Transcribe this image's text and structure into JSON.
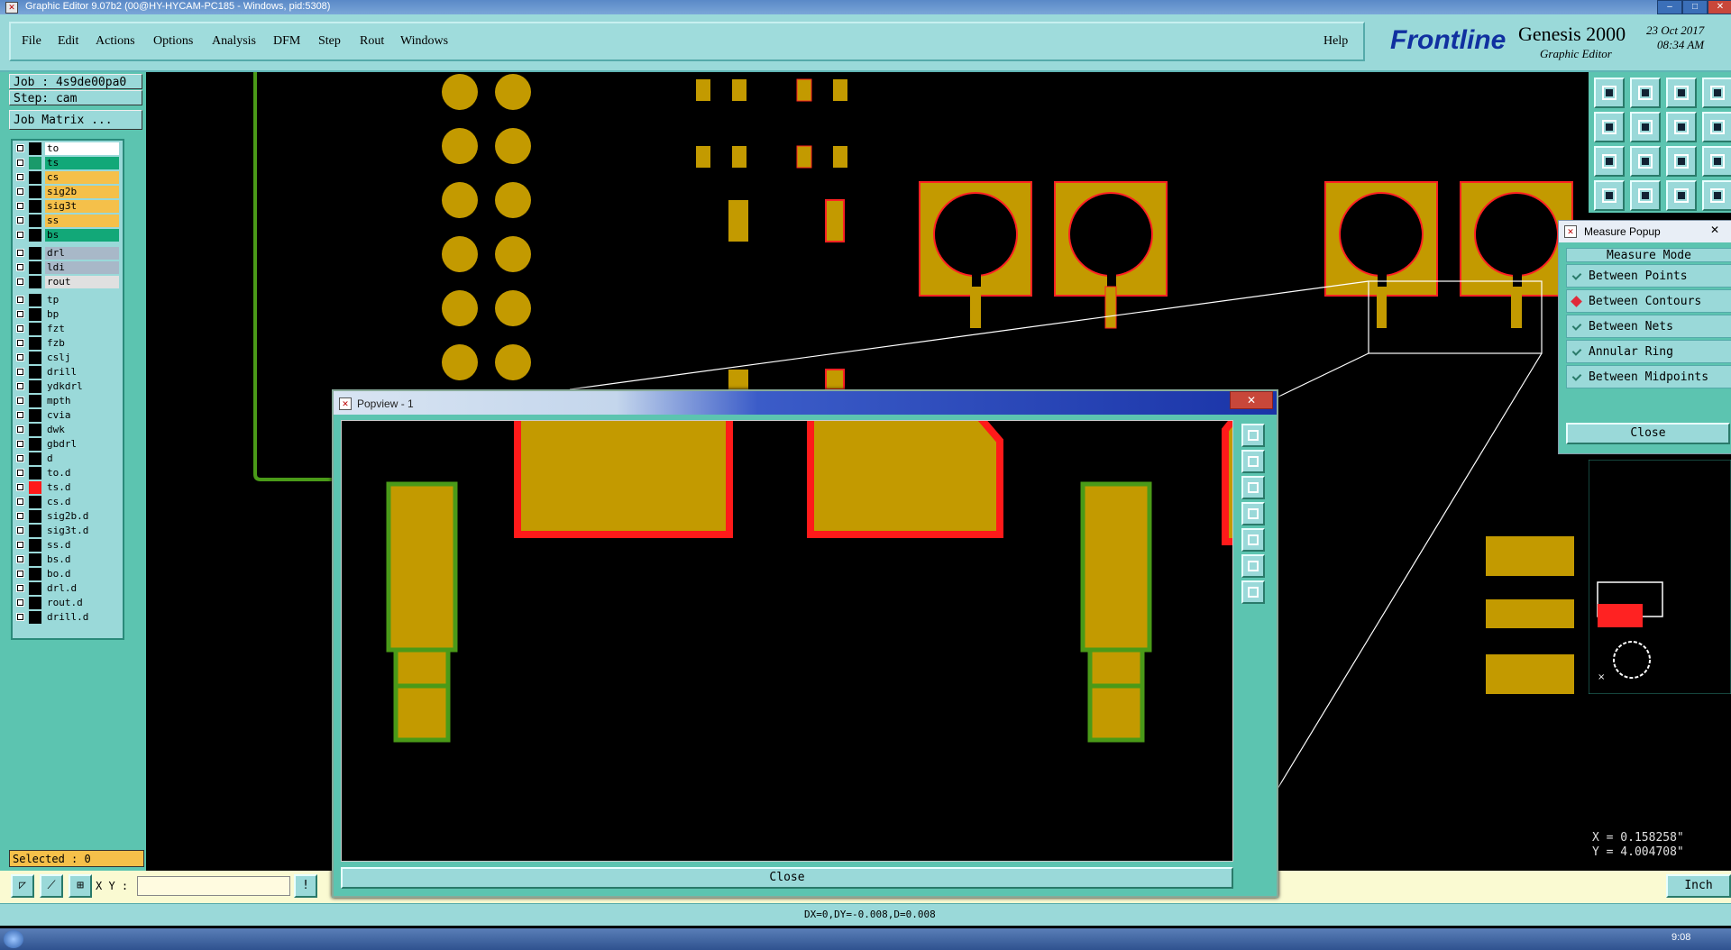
{
  "window": {
    "title": "Graphic Editor 9.07b2 (00@HY-HYCAM-PC185 - Windows, pid:5308)"
  },
  "menu": {
    "items": [
      "File",
      "Edit",
      "Actions",
      "Options",
      "Analysis",
      "DFM",
      "Step",
      "Rout",
      "Windows"
    ],
    "help": "Help"
  },
  "brand": {
    "logo_a": "Front",
    "logo_b": "line",
    "product": "Genesis 2000",
    "module": "Graphic Editor",
    "date": "23 Oct 2017",
    "time": "08:34 AM"
  },
  "job": {
    "job_label": "Job : 4s9de00pa0",
    "step_label": "Step: cam",
    "matrix_button": "Job Matrix ..."
  },
  "layers": [
    {
      "name": "to",
      "color": "#ffffff"
    },
    {
      "name": "ts",
      "color": "#12a878"
    },
    {
      "name": "cs",
      "color": "#f5c04a"
    },
    {
      "name": "sig2b",
      "color": "#f5c04a"
    },
    {
      "name": "sig3t",
      "color": "#f5c04a"
    },
    {
      "name": "ss",
      "color": "#f5c04a"
    },
    {
      "name": "bs",
      "color": "#12a878"
    },
    {
      "name": "drl",
      "color": "#a8b8c8"
    },
    {
      "name": "ldi",
      "color": "#a8b8c8"
    },
    {
      "name": "rout",
      "color": "#e0e0e0"
    },
    {
      "name": "tp",
      "color": "#9ad9d9"
    },
    {
      "name": "bp",
      "color": "#9ad9d9"
    },
    {
      "name": "fzt",
      "color": "#9ad9d9"
    },
    {
      "name": "fzb",
      "color": "#9ad9d9"
    },
    {
      "name": "cslj",
      "color": "#9ad9d9"
    },
    {
      "name": "drill",
      "color": "#9ad9d9"
    },
    {
      "name": "ydkdrl",
      "color": "#9ad9d9"
    },
    {
      "name": "mpth",
      "color": "#9ad9d9"
    },
    {
      "name": "cvia",
      "color": "#9ad9d9"
    },
    {
      "name": "dwk",
      "color": "#9ad9d9"
    },
    {
      "name": "gbdrl",
      "color": "#9ad9d9"
    },
    {
      "name": "d",
      "color": "#9ad9d9"
    },
    {
      "name": "to.d",
      "color": "#9ad9d9"
    },
    {
      "name": "ts.d",
      "color": "#9ad9d9"
    },
    {
      "name": "cs.d",
      "color": "#9ad9d9"
    },
    {
      "name": "sig2b.d",
      "color": "#9ad9d9"
    },
    {
      "name": "sig3t.d",
      "color": "#9ad9d9"
    },
    {
      "name": "ss.d",
      "color": "#9ad9d9"
    },
    {
      "name": "bs.d",
      "color": "#9ad9d9"
    },
    {
      "name": "bo.d",
      "color": "#9ad9d9"
    },
    {
      "name": "drl.d",
      "color": "#9ad9d9"
    },
    {
      "name": "rout.d",
      "color": "#9ad9d9"
    },
    {
      "name": "drill.d",
      "color": "#9ad9d9"
    }
  ],
  "selected": "Selected : 0",
  "measure": {
    "title": "Measure Popup",
    "mode_header": "Measure Mode",
    "options": [
      "Between Points",
      "Between Contours",
      "Between Nets",
      "Annular Ring",
      "Between Midpoints"
    ],
    "active": "Between Contours",
    "close": "Close"
  },
  "popview": {
    "title": "Popview - 1",
    "close": "Close"
  },
  "coords": {
    "x": "X = 0.158258\"",
    "y": "Y = 4.004708\""
  },
  "input": {
    "xy_label": "X Y :",
    "units": "Inch"
  },
  "status": "DX=0,DY=-0.008,D=0.008",
  "taskbar": {
    "time": "9:08"
  },
  "colors": {
    "copper": "#c39a00",
    "outline_red": "#ff1a1a",
    "outline_green": "#4a9a18",
    "panel": "#5cc4b0",
    "panel_light": "#9ad9d9"
  }
}
